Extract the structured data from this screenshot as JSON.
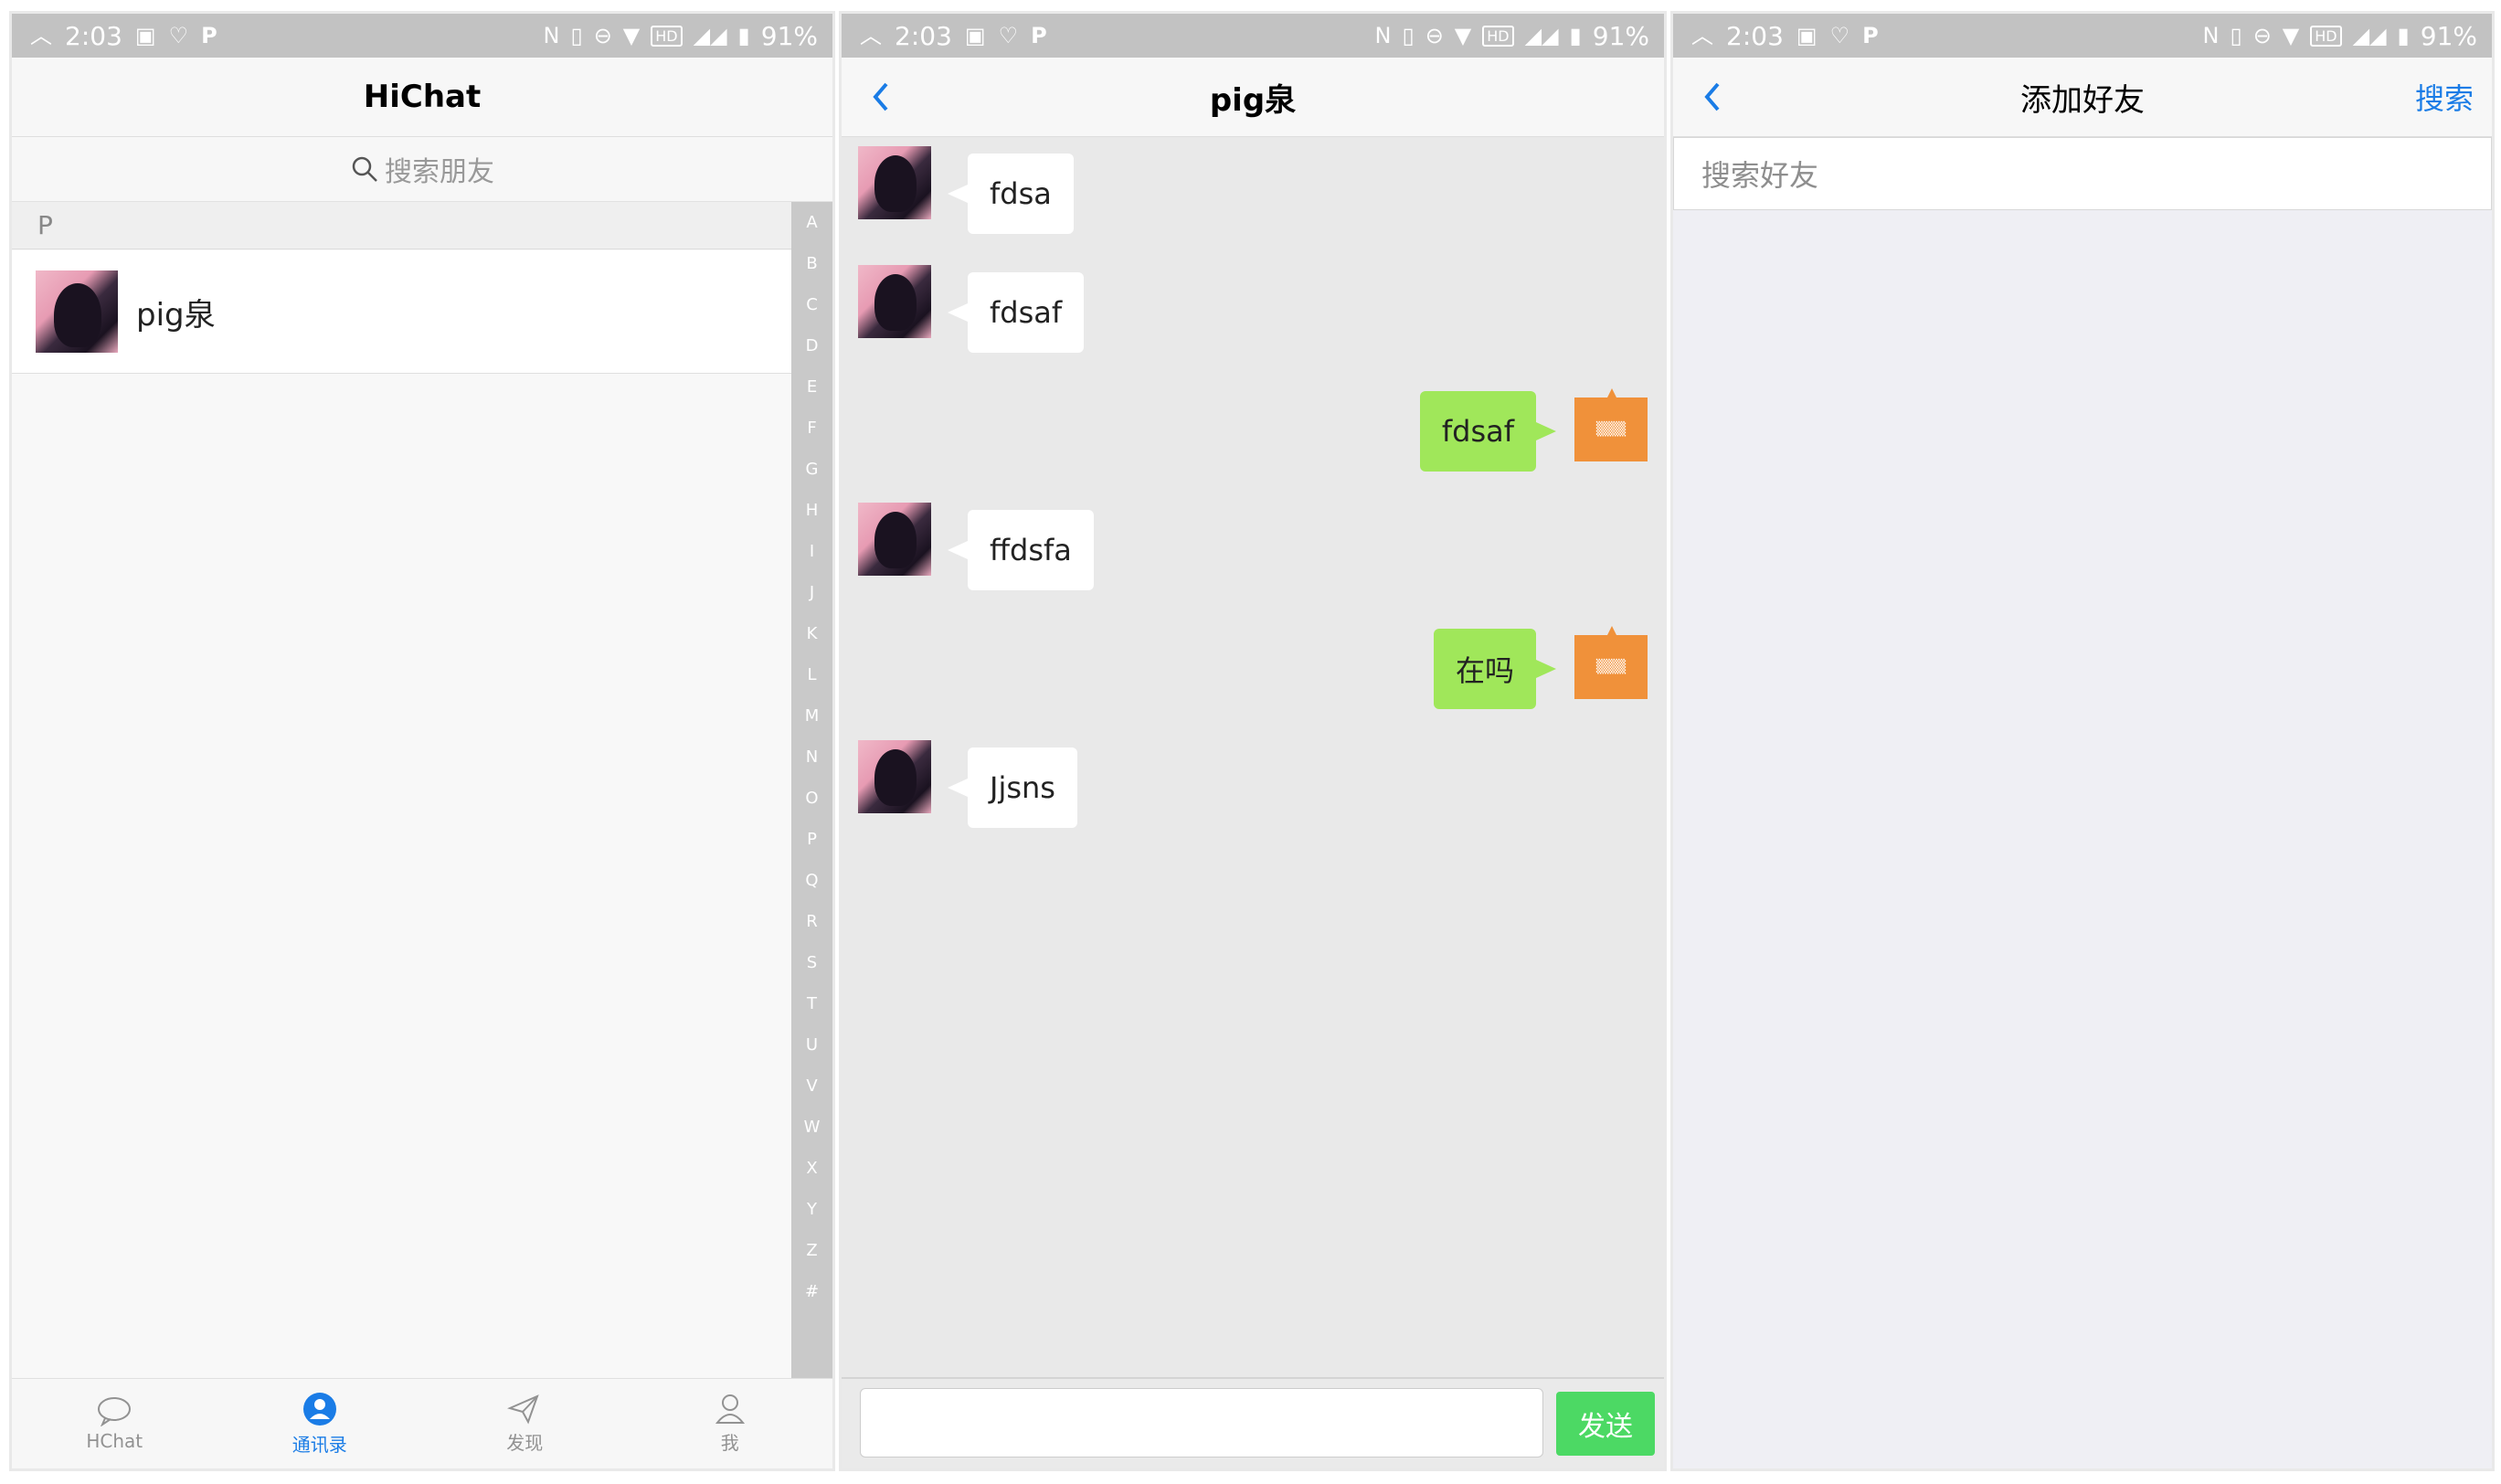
{
  "statusbar": {
    "time": "2:03",
    "battery": "91%",
    "hd": "HD"
  },
  "contacts_screen": {
    "title": "HiChat",
    "search_placeholder": "搜索朋友",
    "section_letter": "P",
    "contacts": [
      {
        "name": "pig泉"
      }
    ],
    "index_letters": [
      "A",
      "B",
      "C",
      "D",
      "E",
      "F",
      "G",
      "H",
      "I",
      "J",
      "K",
      "L",
      "M",
      "N",
      "O",
      "P",
      "Q",
      "R",
      "S",
      "T",
      "U",
      "V",
      "W",
      "X",
      "Y",
      "Z",
      "#"
    ],
    "tabs": [
      {
        "label": "HChat",
        "icon": "chat-bubble-icon"
      },
      {
        "label": "通讯录",
        "icon": "contacts-person-icon",
        "active": true
      },
      {
        "label": "发现",
        "icon": "discover-paper-plane-icon"
      },
      {
        "label": "我",
        "icon": "me-person-icon"
      }
    ],
    "accent_color": "#1a7ce6"
  },
  "chat_screen": {
    "title": "pig泉",
    "messages": [
      {
        "side": "left",
        "text": "fdsa"
      },
      {
        "side": "left",
        "text": "fdsaf"
      },
      {
        "side": "right",
        "text": "fdsaf"
      },
      {
        "side": "left",
        "text": "ffdsfa"
      },
      {
        "side": "right",
        "text": "在吗"
      },
      {
        "side": "left",
        "text": "Jjsns"
      }
    ],
    "send_label": "发送",
    "send_color": "#4cd964",
    "outgoing_bubble_color": "#a0e75a"
  },
  "add_friend_screen": {
    "title": "添加好友",
    "search_button": "搜索",
    "search_placeholder": "搜索好友"
  }
}
